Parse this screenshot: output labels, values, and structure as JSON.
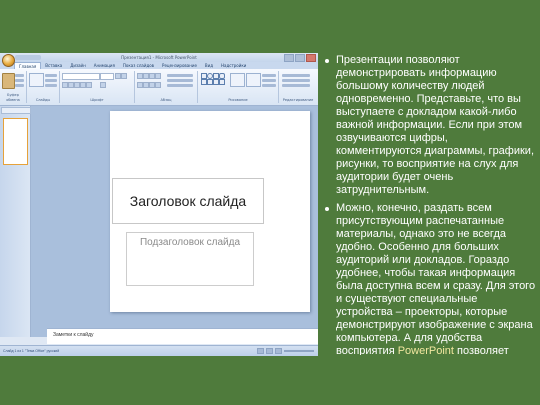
{
  "powerpoint": {
    "window_title": "Презентация1 - Microsoft PowerPoint",
    "tabs": [
      "Главная",
      "Вставка",
      "Дизайн",
      "Анимация",
      "Показ слайдов",
      "Рецензирование",
      "Вид",
      "Надстройки"
    ],
    "ribbon_groups": [
      "Буфер обмена",
      "Слайды",
      "Шрифт",
      "Абзац",
      "Рисование",
      "Редактирование"
    ],
    "slide_title": "Заголовок слайда",
    "slide_subtitle": "Подзаголовок слайда",
    "notes_placeholder": "Заметки к слайду",
    "status": "Слайд 1 из 1    \"Тема Office\"    русский"
  },
  "text_column": {
    "paragraph_1": "Презентации позволяют демонстрировать информацию большому количеству людей одновременно. Представьте, что вы выступаете с докладом какой-либо важной информации. Если при этом озвучиваются цифры, комментируются диаграммы, графики, рисунки, то восприятие на слух для аудитории будет очень затруднительным.",
    "paragraph_2_start": "Можно, конечно, раздать всем присутствующим распечатанные материалы, однако это не всегда удобно. Особенно для больших аудиторий или докладов. Гораздо удобнее, чтобы такая информация была доступна всем и сразу. Для этого и существуют специальные устройства – проекторы, которые демонстрируют изображение с экрана компьютера. А для удобства восприятия",
    "paragraph_2_highlight": "PowerPoint",
    "paragraph_2_end": "позволяет создавать красивые и удобные"
  },
  "colors": {
    "background": "#4f7b3c",
    "highlight": "#f2e7a0"
  }
}
